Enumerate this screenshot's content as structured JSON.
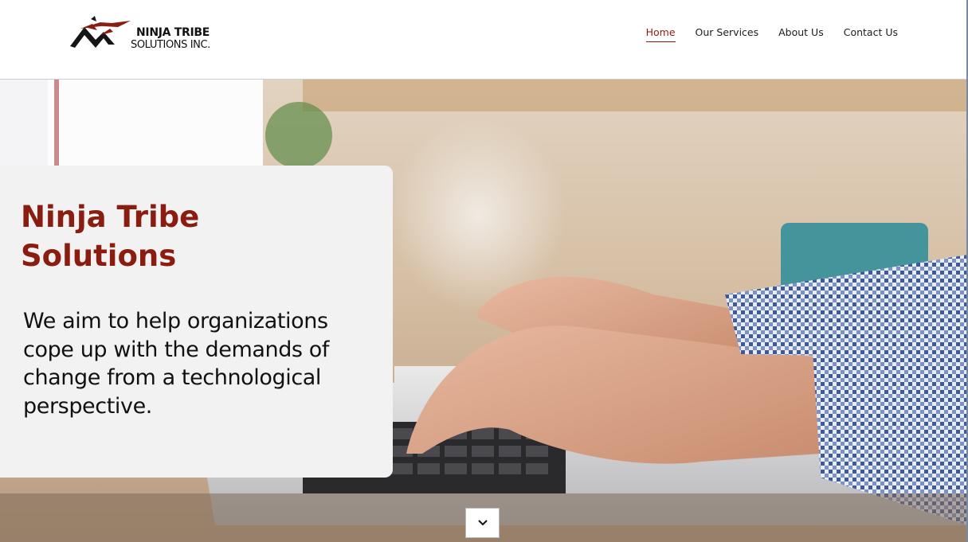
{
  "brand": {
    "name_line1": "NINJA TRIBE",
    "name_line2": "SOLUTIONS INC.",
    "logo_icon": "ninja-tribe-logo-icon",
    "accent_color": "#8b1d10"
  },
  "nav": {
    "items": [
      {
        "label": "Home",
        "active": true
      },
      {
        "label": "Our Services",
        "active": false
      },
      {
        "label": "About Us",
        "active": false
      },
      {
        "label": "Contact Us",
        "active": false
      }
    ]
  },
  "hero": {
    "title": "Ninja Tribe Solutions",
    "description": "We aim to help organizations cope up with the demands of change from a technological perspective.",
    "scroll_icon": "chevron-down-icon"
  }
}
